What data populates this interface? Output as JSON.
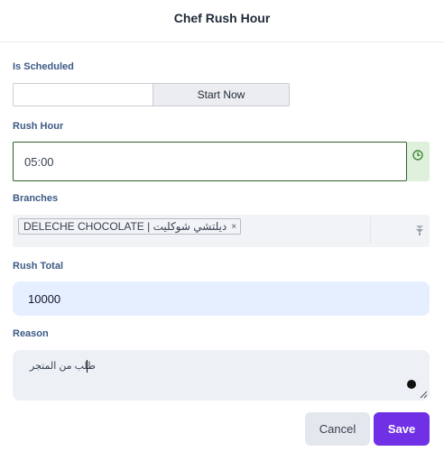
{
  "dialog": {
    "title": "Chef Rush Hour"
  },
  "is_scheduled": {
    "label": "Is Scheduled",
    "options": [
      "",
      "Start Now"
    ],
    "selected": "Start Now"
  },
  "rush_hour": {
    "label": "Rush Hour",
    "value": "05:00",
    "icon": "clock-icon"
  },
  "branches": {
    "label": "Branches",
    "selected_tags": [
      {
        "text": "DELECHE CHOCOLATE | ديلتشي شوكليت",
        "remove": "×"
      }
    ]
  },
  "rush_total": {
    "label": "Rush Total",
    "value": "10000"
  },
  "reason": {
    "label": "Reason",
    "value": "طلب من المتجر"
  },
  "actions": {
    "cancel": "Cancel",
    "save": "Save"
  },
  "colors": {
    "label": "#3b5a85",
    "active_border": "#2e5e2c",
    "addon_bg": "#dff1dc",
    "primary": "#7030e6"
  }
}
